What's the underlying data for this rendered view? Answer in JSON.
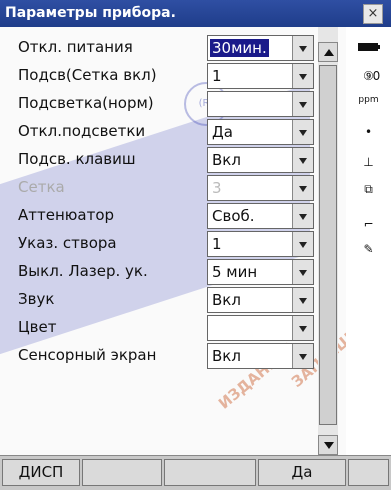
{
  "window": {
    "title": "Параметры прибора.",
    "close_label": "×"
  },
  "settings": [
    {
      "label": "Откл. питания",
      "value": "30мин.",
      "selected": true,
      "dim_label": false,
      "dim_value": false
    },
    {
      "label": "Подсв(Сетка вкл)",
      "value": "1",
      "selected": false,
      "dim_label": false,
      "dim_value": false
    },
    {
      "label": "Подсветка(норм)",
      "value": "",
      "selected": false,
      "dim_label": false,
      "dim_value": false
    },
    {
      "label": "Откл.подсветки",
      "value": "Да",
      "selected": false,
      "dim_label": false,
      "dim_value": false
    },
    {
      "label": "Подсв. клавиш",
      "value": "Вкл",
      "selected": false,
      "dim_label": false,
      "dim_value": false
    },
    {
      "label": "Сетка",
      "value": "3",
      "selected": false,
      "dim_label": true,
      "dim_value": true
    },
    {
      "label": "Аттенюатор",
      "value": "Своб.",
      "selected": false,
      "dim_label": false,
      "dim_value": false
    },
    {
      "label": "Указ. створа",
      "value": "1",
      "selected": false,
      "dim_label": false,
      "dim_value": false
    },
    {
      "label": "Выкл. Лазер. ук.",
      "value": "5 мин",
      "selected": false,
      "dim_label": false,
      "dim_value": false
    },
    {
      "label": "Звук",
      "value": "Вкл",
      "selected": false,
      "dim_label": false,
      "dim_value": false
    },
    {
      "label": "Цвет",
      "value": "",
      "selected": false,
      "dim_label": false,
      "dim_value": false
    },
    {
      "label": "Сенсорный экран",
      "value": "Вкл",
      "selected": false,
      "dim_label": false,
      "dim_value": false
    }
  ],
  "status_bar": {
    "value": "0",
    "label_small": "ppm"
  },
  "softkeys": {
    "left": "ДИСП",
    "right": "Да"
  },
  "watermark": {
    "line1": "ЗАПРЕЩЕНО!",
    "line2": "ИЗДАНИЯ\""
  }
}
